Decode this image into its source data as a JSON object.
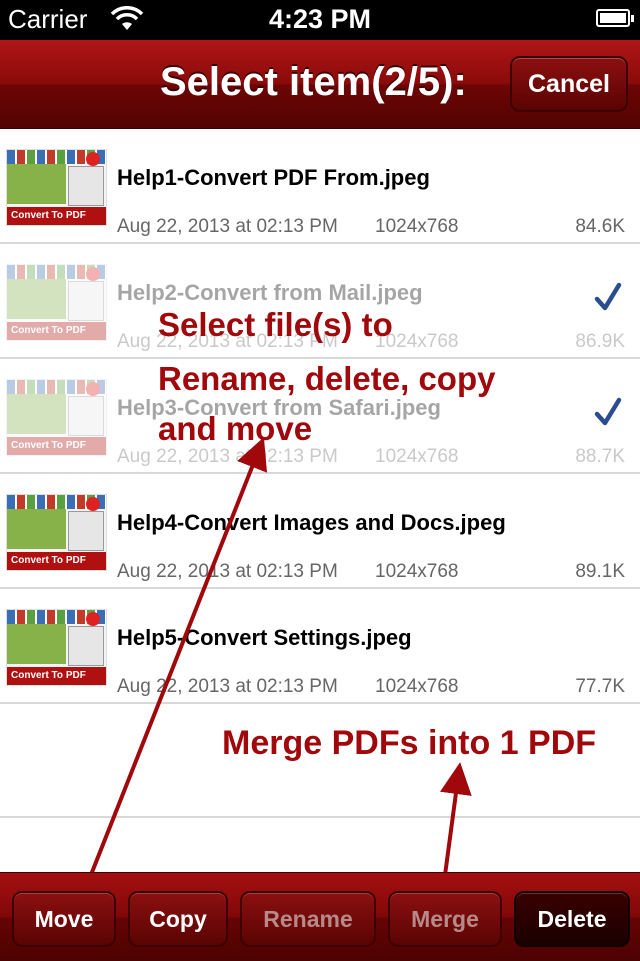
{
  "status_bar": {
    "carrier": "Carrier",
    "time": "4:23 PM"
  },
  "nav": {
    "title": "Select item(2/5):",
    "cancel_label": "Cancel"
  },
  "files": [
    {
      "name": "Help1-Convert PDF From.jpeg",
      "date": "Aug 22, 2013 at 02:13 PM",
      "dimensions": "1024x768",
      "size": "84.6K",
      "selected": false,
      "thumb_label": "Convert To PDF"
    },
    {
      "name": "Help2-Convert from Mail.jpeg",
      "date": "Aug 22, 2013 at 02:13 PM",
      "dimensions": "1024x768",
      "size": "86.9K",
      "selected": true,
      "thumb_label": "Convert To PDF"
    },
    {
      "name": "Help3-Convert from Safari.jpeg",
      "date": "Aug 22, 2013 at 02:13 PM",
      "dimensions": "1024x768",
      "size": "88.7K",
      "selected": true,
      "thumb_label": "Convert To PDF"
    },
    {
      "name": "Help4-Convert Images and Docs.jpeg",
      "date": "Aug 22, 2013 at 02:13 PM",
      "dimensions": "1024x768",
      "size": "89.1K",
      "selected": false,
      "thumb_label": "Convert To PDF"
    },
    {
      "name": "Help5-Convert Settings.jpeg",
      "date": "Aug 22, 2013 at 02:13 PM",
      "dimensions": "1024x768",
      "size": "77.7K",
      "selected": false,
      "thumb_label": "Convert To PDF"
    }
  ],
  "annotations": {
    "select_line1": "Select file(s) to",
    "select_line2": "Rename, delete, copy",
    "select_line3": "and move",
    "merge": "Merge PDFs into 1 PDF"
  },
  "toolbar": {
    "move": "Move",
    "copy": "Copy",
    "rename": "Rename",
    "merge": "Merge",
    "delete": "Delete"
  },
  "colors": {
    "brand_red": "#8a0a0a",
    "annotation_red": "#a0080b",
    "checkmark_blue": "#2a4d8f"
  }
}
